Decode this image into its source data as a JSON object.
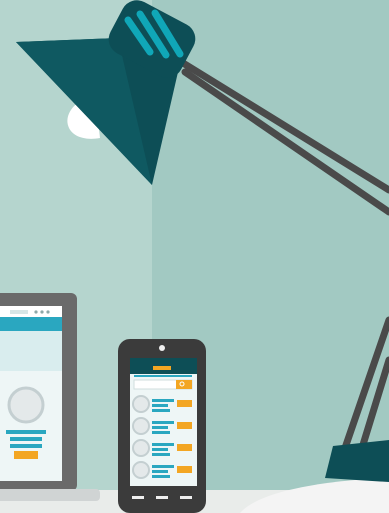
{
  "scene": {
    "description_hidden": "",
    "colors": {
      "wall_left": "#b5d5ce",
      "wall_right": "#9ec6bf",
      "lamp_dark": "#0d4e56",
      "lamp_accent": "#10a7b8",
      "arm": "#4a4a4a",
      "bulb": "#ffffff",
      "screen_blue": "#2aa7c0",
      "screen_orange": "#f3a623",
      "device_dark": "#3b3b3b",
      "device_gray": "#6a6a6a",
      "desk": "#f0f0f0"
    },
    "laptop": {
      "icon": "laptop-icon"
    },
    "phone": {
      "icon": "smartphone-icon",
      "list_rows": 4
    },
    "lamp": {
      "icon": "desk-lamp-icon"
    }
  }
}
